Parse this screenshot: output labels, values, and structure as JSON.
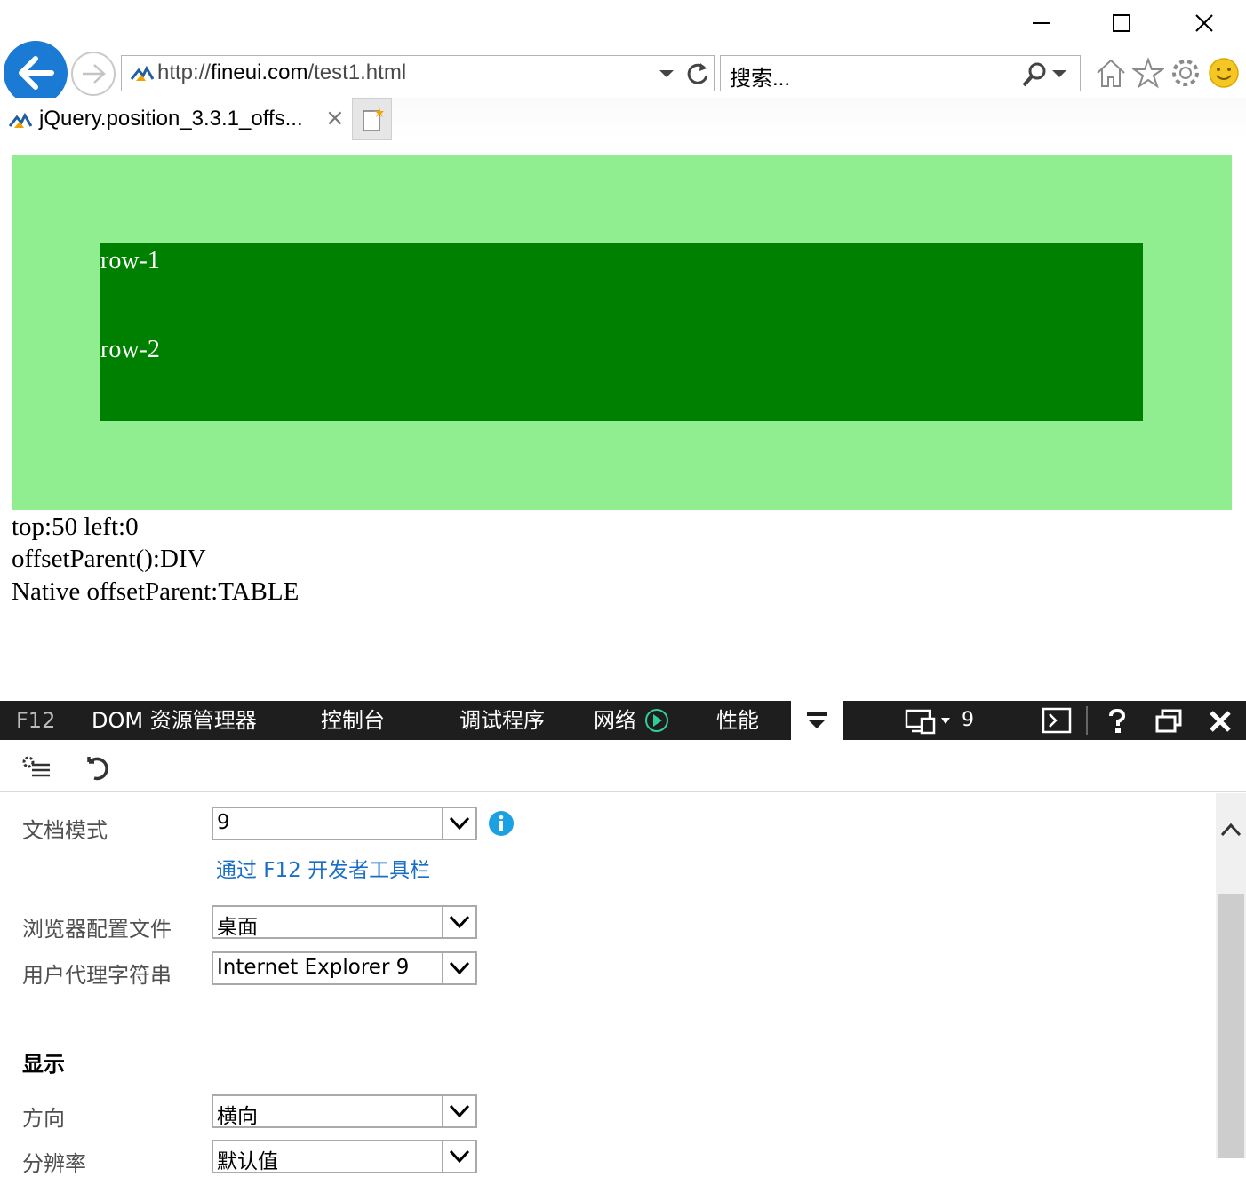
{
  "browser": {
    "address_prefix": "http://",
    "address_domain": "fineui.com",
    "address_path": "/test1.html",
    "search_placeholder": "搜索...",
    "tab_title": "jQuery.position_3.3.1_offs...",
    "tab_close": "×"
  },
  "page": {
    "rows": [
      "row-1",
      "row-2"
    ],
    "info_lines": [
      "top:50 left:0",
      "offsetParent():DIV",
      "Native offsetParent:TABLE"
    ],
    "colors": {
      "outer": "#90ee90",
      "inner": "#008000"
    }
  },
  "devtools": {
    "tabs": [
      "F12",
      "DOM 资源管理器",
      "控制台",
      "调试程序",
      "网络",
      "性能"
    ],
    "device_value": "9",
    "fields": {
      "doc_mode_label": "文档模式",
      "doc_mode_value": "9",
      "doc_mode_link": "通过 F12 开发者工具栏",
      "browser_profile_label": "浏览器配置文件",
      "browser_profile_value": "桌面",
      "ua_label": "用户代理字符串",
      "ua_value": "Internet Explorer 9",
      "display_heading": "显示",
      "orientation_label": "方向",
      "orientation_value": "横向",
      "resolution_label": "分辨率",
      "resolution_value": "默认值"
    }
  }
}
